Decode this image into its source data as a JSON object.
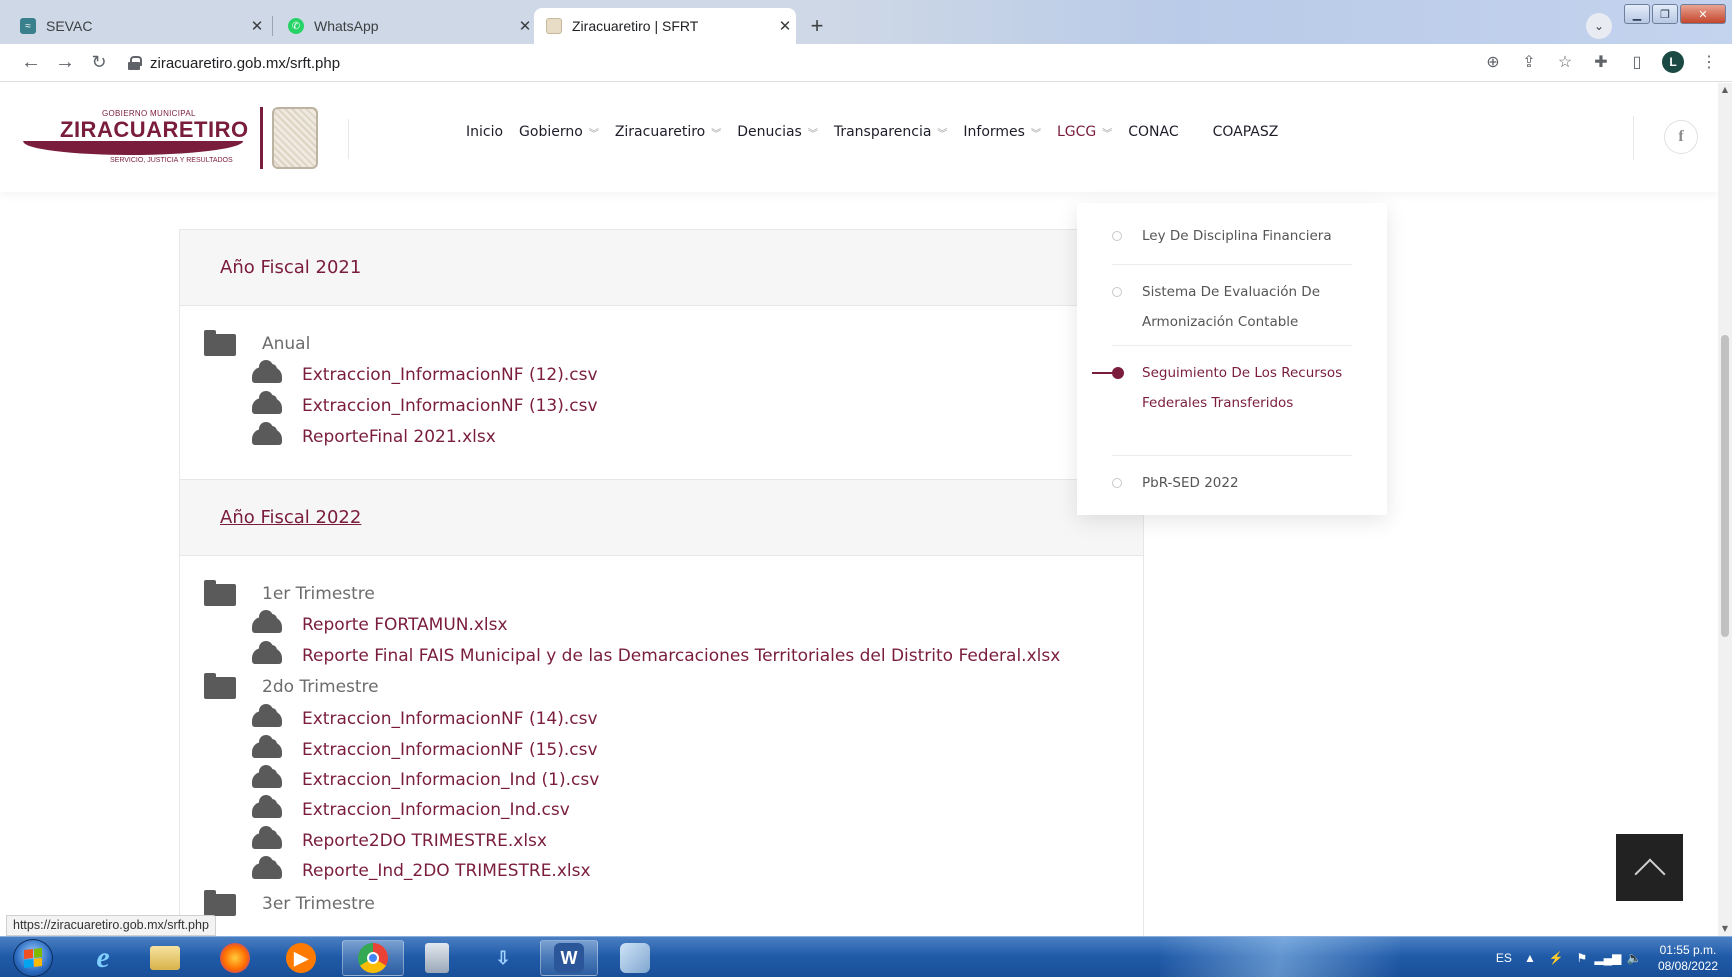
{
  "browser": {
    "tabs": [
      {
        "title": "SEVAC",
        "favicon": "sevac-favicon"
      },
      {
        "title": "WhatsApp",
        "favicon": "whatsapp-favicon"
      },
      {
        "title": "Ziracuaretiro | SFRT",
        "favicon": "ziracuaretiro-favicon",
        "active": true
      }
    ],
    "url": "ziracuaretiro.gob.mx/srft.php",
    "profile_initial": "L",
    "status_url": "https://ziracuaretiro.gob.mx/srft.php"
  },
  "site": {
    "logo": {
      "top_text": "GOBIERNO MUNICIPAL",
      "name": "ZIRACUARETIRO",
      "tagline": "SERVICIO, JUSTICIA Y RESULTADOS"
    },
    "nav": [
      {
        "label": "Inicio",
        "dropdown": false
      },
      {
        "label": "Gobierno",
        "dropdown": true
      },
      {
        "label": "Ziracuaretiro",
        "dropdown": true
      },
      {
        "label": "Denucias",
        "dropdown": true
      },
      {
        "label": "Transparencia",
        "dropdown": true
      },
      {
        "label": "Informes",
        "dropdown": true
      },
      {
        "label": "LGCG",
        "dropdown": true,
        "active": true
      },
      {
        "label": "CONAC",
        "dropdown": false
      },
      {
        "label": "COAPASZ",
        "dropdown": false
      }
    ],
    "social": "f"
  },
  "dropdown_menu": {
    "items": [
      {
        "label": "Ley De Disciplina Financiera"
      },
      {
        "label": "Sistema De Evaluación De Armonización Contable"
      },
      {
        "label": "Seguimiento De Los Recursos Federales Transferidos",
        "active": true
      },
      {
        "label": "PbR-SED 2022"
      }
    ]
  },
  "content": {
    "panels": [
      {
        "title": "Año Fiscal 2021",
        "folders": [
          {
            "name": "Anual",
            "files": [
              "Extraccion_InformacionNF (12).csv",
              "Extraccion_InformacionNF (13).csv",
              "ReporteFinal 2021.xlsx"
            ]
          }
        ]
      },
      {
        "title": "Año Fiscal 2022",
        "folders": [
          {
            "name": "1er Trimestre",
            "files": [
              "Reporte FORTAMUN.xlsx",
              "Reporte Final FAIS Municipal y de las Demarcaciones Territoriales del Distrito Federal.xlsx"
            ]
          },
          {
            "name": "2do Trimestre",
            "files": [
              "Extraccion_InformacionNF (14).csv",
              "Extraccion_InformacionNF (15).csv",
              "Extraccion_Informacion_Ind (1).csv",
              "Extraccion_Informacion_Ind.csv",
              "Reporte2DO TRIMESTRE.xlsx",
              "Reporte_Ind_2DO TRIMESTRE.xlsx"
            ]
          },
          {
            "name": "3er Trimestre",
            "files": []
          }
        ]
      }
    ]
  },
  "taskbar": {
    "language": "ES",
    "time": "01:55 p.m.",
    "date": "08/08/2022"
  },
  "colors": {
    "brand": "#7a1d3c",
    "taskbar": "#1f5aa8"
  }
}
